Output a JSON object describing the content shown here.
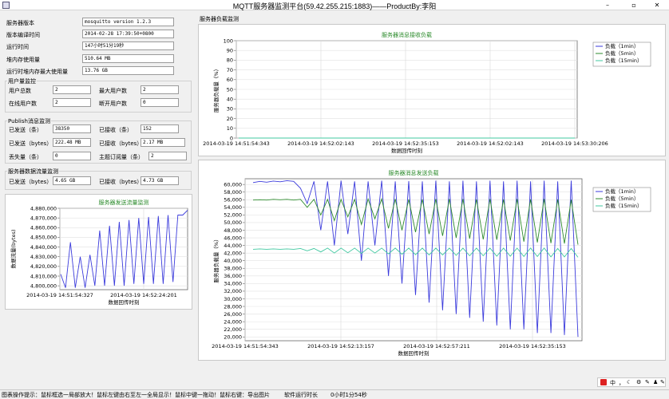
{
  "window": {
    "title": "MQTT服务器监测平台(59.42.255.215:1883)——ProductBy:李阳",
    "min": "–",
    "max": "▫",
    "close": "✕"
  },
  "info": {
    "rows": [
      {
        "label": "服务器版本",
        "value": "mosquitto version 1.2.3"
      },
      {
        "label": "版本编译时间",
        "value": "2014-02-28 17:39:50+0800"
      },
      {
        "label": "运行时间",
        "value": "147小时51分19秒"
      },
      {
        "label": "堆内存使用量",
        "value": "510.64 MB"
      },
      {
        "label": "运行时堆内存最大使用量",
        "value": "13.76 GB"
      }
    ]
  },
  "users": {
    "title": "用户量监控",
    "total_label": "用户总数",
    "total_value": "2",
    "max_label": "最大用户数",
    "max_value": "2",
    "online_label": "在线用户数",
    "online_value": "2",
    "offline_label": "断开用户数",
    "offline_value": "0"
  },
  "publish": {
    "title": "Publish消息监测",
    "sent_count_label": "已发送（条）",
    "sent_count_value": "38350",
    "recv_count_label": "已接收（条）",
    "recv_count_value": "152",
    "sent_bytes_label": "已发送（bytes）",
    "sent_bytes_value": "222.48 MB",
    "recv_bytes_label": "已接收（bytes）",
    "recv_bytes_value": "2.17 MB",
    "lost_label": "丢失量（条）",
    "lost_value": "0",
    "sub_label": "主题订阅量（条）",
    "sub_value": "2"
  },
  "traffic": {
    "title": "服务器数据流量监测",
    "sent_label": "已发送（bytes）",
    "sent_value": "4.65 GB",
    "recv_label": "已接收（bytes）",
    "recv_value": "4.73 GB"
  },
  "load_section_title": "服务器负载监测",
  "statusbar": {
    "hint": "图表操作提示：鼠标框选一局部放大！鼠标左键由右至左一全局显示！鼠标中键一拖动！鼠标右键：导出图片",
    "runtime_label": "软件运行时长",
    "runtime_value": "0小时1分54秒"
  },
  "tray": {
    "items": [
      "中",
      "，",
      "☾",
      "⚙",
      "✎",
      "♟",
      "✎"
    ]
  },
  "chart_data": [
    {
      "type": "line",
      "title": "服务器发送流量监测",
      "xlabel": "数据回传时刻",
      "ylabel": "数据流量(bytes)",
      "yticks": [
        "4,880,000",
        "4,870,000",
        "4,860,000",
        "4,850,000",
        "4,840,000",
        "4,830,000",
        "4,820,000",
        "4,810,000",
        "4,800,000"
      ],
      "xticks": [
        "2014-03-19 14:51:54:327",
        "2014-03-19 14:52:24:201"
      ],
      "ylim": [
        4796000,
        4880000
      ],
      "series": [
        {
          "color": "#3b3bdc",
          "values": [
            4812000,
            4798000,
            4845000,
            4798000,
            4830000,
            4798000,
            4832000,
            4800000,
            4857000,
            4800000,
            4862000,
            4800000,
            4866000,
            4800000,
            4868000,
            4802000,
            4870000,
            4802000,
            4871000,
            4802000,
            4872000,
            4802000,
            4873000,
            4804000,
            4873000,
            4873000,
            4878000
          ]
        }
      ]
    },
    {
      "type": "line",
      "title": "服务器消息接收负载",
      "xlabel": "数据回传时刻",
      "ylabel": "服务器负载量（%）",
      "yticks": [
        "100",
        "90",
        "80",
        "70",
        "60",
        "50",
        "40",
        "30",
        "20",
        "10",
        "0"
      ],
      "xticks": [
        "2014-03-19 14:51:54:343",
        "2014-03-19 14:52:02:143",
        "2014-03-19 14:52:35:153",
        "2014-03-19 14:52:02:143",
        "2014-03-19 14:53:30:206"
      ],
      "ylim": [
        0,
        100
      ],
      "legend_position": "top-right",
      "series": [
        {
          "name": "负载（1min）",
          "color": "#3b3bdc",
          "values": [
            0,
            0,
            0,
            0,
            0,
            0,
            0,
            0,
            0,
            0,
            0,
            0
          ]
        },
        {
          "name": "负载（5min）",
          "color": "#2e8b2e",
          "values": [
            0,
            0,
            0,
            0,
            0,
            0,
            0,
            0,
            0,
            0,
            0,
            0
          ]
        },
        {
          "name": "负载（15min）",
          "color": "#40c8a0",
          "values": [
            0,
            0,
            0,
            0,
            0,
            0,
            0,
            0,
            0,
            0,
            0,
            0
          ]
        }
      ]
    },
    {
      "type": "line",
      "title": "服务器消息发送负载",
      "xlabel": "数据回传时刻",
      "ylabel": "服务器负载量（%）",
      "yticks": [
        "60,000",
        "58,000",
        "56,000",
        "54,000",
        "52,000",
        "50,000",
        "48,000",
        "46,000",
        "44,000",
        "42,000",
        "40,000",
        "38,000",
        "36,000",
        "34,000",
        "32,000",
        "30,000",
        "28,000",
        "26,000",
        "24,000",
        "22,000",
        "20,000"
      ],
      "xticks": [
        "2014-03-19 14:51:54:343",
        "2014-03-19 14:52:13:157",
        "2014-03-19 14:52:57:211",
        "2014-03-19 14:52:35:153"
      ],
      "ylim": [
        19000,
        61500
      ],
      "legend_position": "top-right",
      "series": [
        {
          "name": "负载（1min）",
          "color": "#3b3bdc",
          "values": [
            60500,
            60800,
            60600,
            60900,
            60700,
            61000,
            60800,
            59000,
            55000,
            60800,
            48000,
            60800,
            44000,
            61000,
            47000,
            60800,
            40000,
            60800,
            44000,
            61000,
            36000,
            60800,
            34000,
            60900,
            31000,
            60800,
            29000,
            61000,
            27000,
            60800,
            26000,
            61000,
            25000,
            60800,
            24000,
            61000,
            23000,
            60800,
            22000,
            61000,
            22000,
            60800,
            21000,
            61000,
            21000,
            60800,
            20500,
            61000,
            20000
          ]
        },
        {
          "name": "负载（5min）",
          "color": "#2e8b2e",
          "values": [
            55900,
            56000,
            55900,
            56100,
            56000,
            56100,
            55900,
            56100,
            54000,
            56100,
            52000,
            56100,
            50500,
            56100,
            51500,
            56100,
            49500,
            56200,
            51000,
            56200,
            48500,
            56200,
            48000,
            56100,
            47500,
            56100,
            47000,
            56200,
            46500,
            56200,
            46000,
            56200,
            45800,
            56100,
            45600,
            56200,
            45500,
            56100,
            45300,
            56200,
            45000,
            56100,
            44800,
            56200,
            44600,
            56100,
            44500,
            56000,
            44200
          ]
        },
        {
          "name": "负载（15min）",
          "color": "#40c8a0",
          "values": [
            43000,
            43100,
            43000,
            43100,
            43000,
            43100,
            43000,
            43200,
            42600,
            43200,
            42300,
            43300,
            42000,
            43300,
            42100,
            43300,
            41900,
            43300,
            42000,
            43300,
            41800,
            43300,
            41700,
            43300,
            41600,
            43300,
            41500,
            43300,
            41500,
            43300,
            41400,
            43300,
            41300,
            43300,
            41300,
            43300,
            41200,
            43300,
            41200,
            43300,
            41100,
            43300,
            41100,
            43300,
            41000,
            43200,
            41000,
            43200,
            40900
          ]
        }
      ]
    }
  ]
}
